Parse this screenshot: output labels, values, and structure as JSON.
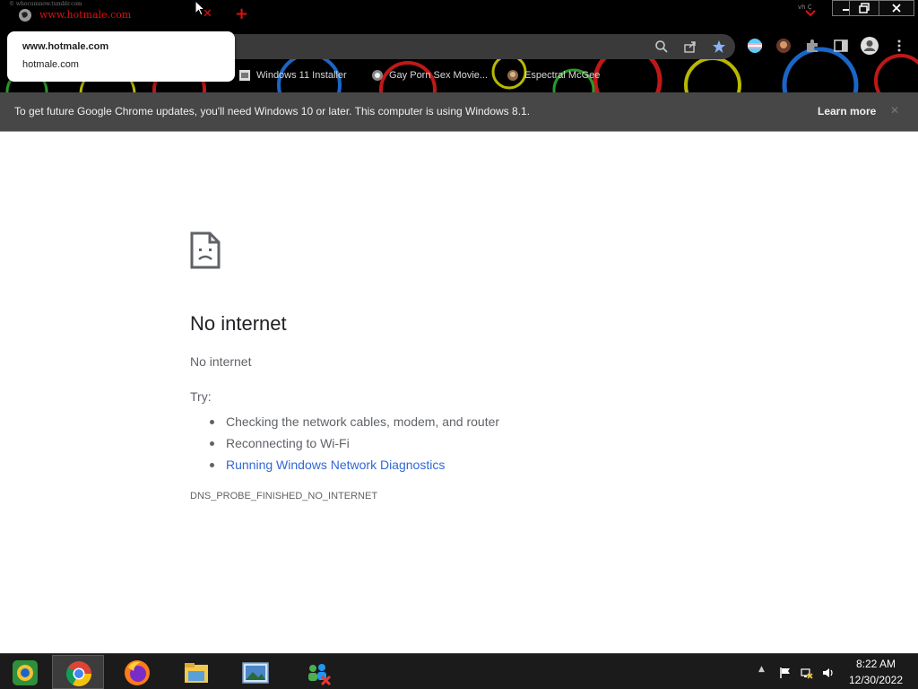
{
  "browser": {
    "tab": {
      "title": "www.hotmale.com",
      "tiny_url": "© whocumnow.tumblr.com",
      "close_glyph": "✕",
      "newtab_glyph": "+",
      "right_tiny": "vh Ç"
    },
    "dropdown": {
      "title": "www.hotmale.com",
      "url": "hotmale.com"
    },
    "bookmarks": [
      {
        "label": "Windows 11 Installer",
        "icon": "page-icon"
      },
      {
        "label": "Gay Porn Sex Movie...",
        "icon": "site-icon"
      },
      {
        "label": "Espectral McGee",
        "icon": "avatar-icon"
      }
    ],
    "infobar": {
      "message": "To get future Google Chrome updates, you'll need Windows 10 or later. This computer is using Windows 8.1.",
      "link": "Learn more",
      "close_glyph": "✕"
    }
  },
  "error_page": {
    "icon": "sad-page-icon",
    "title": "No internet",
    "subtitle": "No internet",
    "try_label": "Try:",
    "suggestions": [
      "Checking the network cables, modem, and router",
      "Reconnecting to Wi-Fi",
      "Running Windows Network Diagnostics"
    ],
    "error_code": "DNS_PROBE_FINISHED_NO_INTERNET"
  },
  "taskbar": {
    "apps": [
      "start-icon",
      "chrome-icon",
      "firefox-icon",
      "file-explorer-icon",
      "photos-icon",
      "network-people-icon"
    ],
    "tray": {
      "chevron": "▲"
    },
    "clock": {
      "time": "8:22 AM",
      "date": "12/30/2022"
    }
  },
  "colors": {
    "link": "#3367d6",
    "tab_text": "#e01010",
    "infobar": "#474747"
  }
}
